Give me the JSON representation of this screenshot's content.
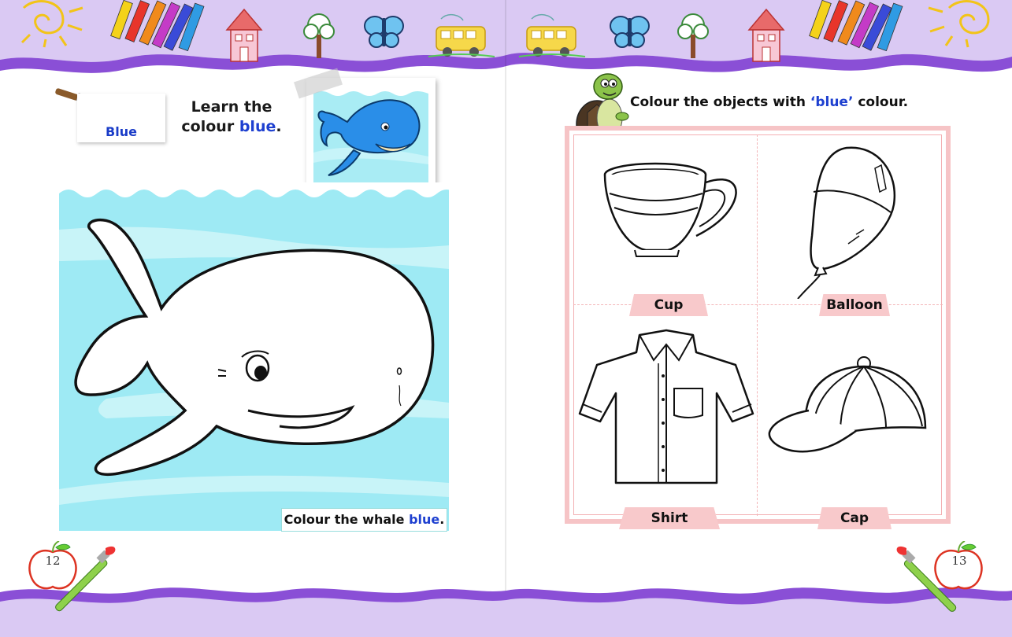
{
  "left_page": {
    "swatch_label": "Blue",
    "learn_title_line1": "Learn the",
    "learn_title_line2_prefix": "colour ",
    "learn_title_line2_colour": "blue",
    "learn_title_line2_suffix": ".",
    "caption_prefix": "Colour the whale ",
    "caption_colour": "blue",
    "caption_suffix": ".",
    "page_number": "12"
  },
  "right_page": {
    "instruction_prefix": "Colour the objects with ",
    "instruction_colour": "‘blue’",
    "instruction_suffix": " colour.",
    "objects": [
      "Cup",
      "Balloon",
      "Shirt",
      "Cap"
    ],
    "page_number": "13"
  },
  "colors": {
    "accent_blue": "#1e40d0",
    "header_lilac": "#d9c8f2",
    "wave_purple": "#8a4fd6",
    "water": "#9eeaf4",
    "label_pink": "#f8c9cb"
  },
  "icons": [
    "sun-icon",
    "crayons-icon",
    "schoolhouse-icon",
    "tree-icon",
    "butterfly-icon",
    "school-bus-icon",
    "turtle-icon",
    "apple-icon",
    "paintbrush-icon"
  ]
}
